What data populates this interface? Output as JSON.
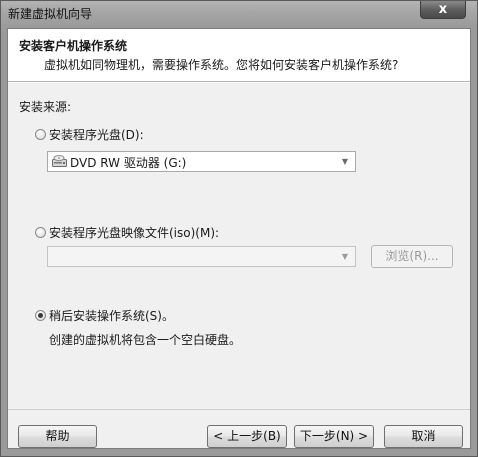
{
  "window": {
    "title": "新建虚拟机向导",
    "close_glyph": "x"
  },
  "header": {
    "title": "安装客户机操作系统",
    "subtitle": "虚拟机如同物理机，需要操作系统。您将如何安装客户机操作系统?"
  },
  "source": {
    "label": "安装来源:",
    "options": [
      {
        "label": "安装程序光盘(D):",
        "selected": false,
        "combo_value": "DVD RW 驱动器 (G:)",
        "combo_icon": "dvd-drive-icon"
      },
      {
        "label": "安装程序光盘映像文件(iso)(M):",
        "selected": false,
        "combo_value": "",
        "browse_label": "浏览(R)..."
      },
      {
        "label": "稍后安装操作系统(S)。",
        "selected": true,
        "description": "创建的虚拟机将包含一个空白硬盘。"
      }
    ]
  },
  "footer": {
    "help_label": "帮助",
    "back_label": "< 上一步(B)",
    "next_label": "下一步(N) >",
    "cancel_label": "取消"
  },
  "icons": {
    "close": "close-icon",
    "dropdown": "chevron-down-icon",
    "drive": "dvd-drive-icon"
  }
}
